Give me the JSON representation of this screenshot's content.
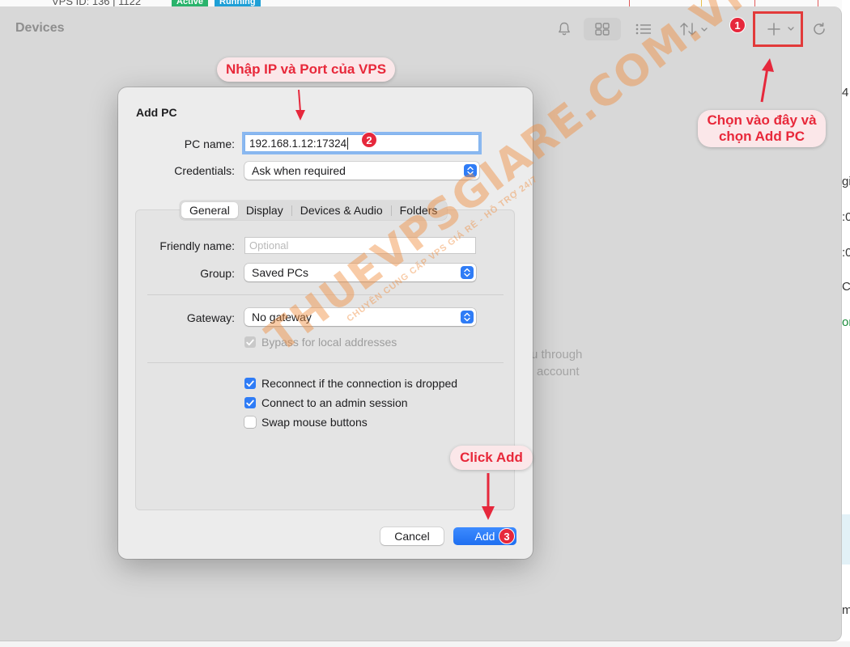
{
  "background": {
    "vps_id": "VPS ID: 136",
    "vps_id_num": "1122",
    "badges": [
      "Active",
      "Running"
    ],
    "right_fragments": [
      "4",
      "gi",
      ":0",
      ":0",
      "C",
      "on",
      "m"
    ],
    "empty_state": [
      "u through",
      "account"
    ]
  },
  "app": {
    "title": "Devices"
  },
  "dialog": {
    "title": "Add PC",
    "pc_name_label": "PC name:",
    "pc_name_value": "192.168.1.12:17324",
    "credentials_label": "Credentials:",
    "credentials_value": "Ask when required",
    "tabs": [
      "General",
      "Display",
      "Devices & Audio",
      "Folders"
    ],
    "friendly_name_label": "Friendly name:",
    "friendly_name_placeholder": "Optional",
    "group_label": "Group:",
    "group_value": "Saved PCs",
    "gateway_label": "Gateway:",
    "gateway_value": "No gateway",
    "bypass_label": "Bypass for local addresses",
    "reconnect_label": "Reconnect if the connection is dropped",
    "admin_label": "Connect to an admin session",
    "swap_label": "Swap mouse buttons",
    "cancel_label": "Cancel",
    "add_label": "Add"
  },
  "annotations": {
    "top_callout": "Nhập IP và Port của VPS",
    "right_callout_line1": "Chọn vào đây và",
    "right_callout_line2": "chọn Add PC",
    "bottom_callout": "Click Add",
    "step1": "1",
    "step2": "2",
    "step3": "3",
    "accent_color": "#e6283c"
  },
  "watermark": {
    "main": "THUEVPSGIARE.COM.VN",
    "sub": "CHUYÊN CUNG CẤP VPS GIÁ RẺ - HỖ TRỢ 24/7"
  }
}
